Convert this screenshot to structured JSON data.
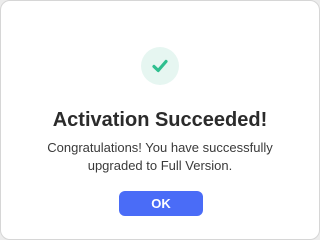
{
  "dialog": {
    "icon": "checkmark-icon",
    "title": "Activation Succeeded!",
    "message_line1": "Congratulations! You have successfully",
    "message_line2": "upgraded to Full Version.",
    "ok_label": "OK"
  },
  "colors": {
    "accent": "#4a6cf7",
    "success": "#2fbf8f",
    "success_bg": "#e6f6f1"
  }
}
